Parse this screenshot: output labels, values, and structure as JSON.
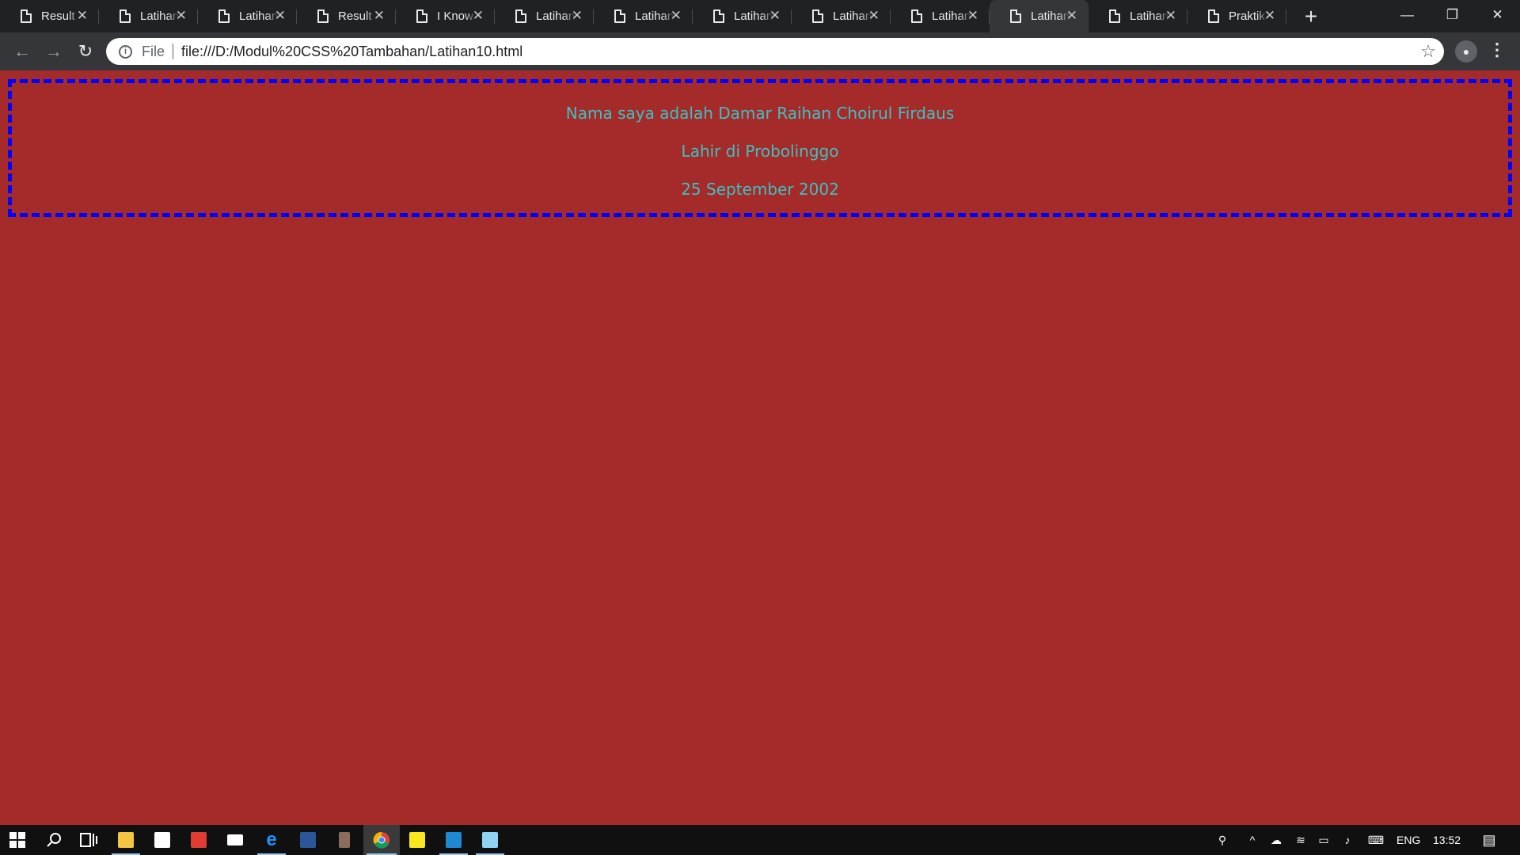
{
  "browser": {
    "tabs": [
      {
        "title": "Result",
        "active": false
      },
      {
        "title": "Latihan",
        "active": false
      },
      {
        "title": "Latihan",
        "active": false
      },
      {
        "title": "Result",
        "active": false
      },
      {
        "title": "I Know",
        "active": false
      },
      {
        "title": "Latihan",
        "active": false
      },
      {
        "title": "Latihan",
        "active": false
      },
      {
        "title": "Latihan",
        "active": false
      },
      {
        "title": "Latihan",
        "active": false
      },
      {
        "title": "Latihan",
        "active": false
      },
      {
        "title": "Latihan",
        "active": true
      },
      {
        "title": "Latihan",
        "active": false
      },
      {
        "title": "Praktik",
        "active": false
      }
    ],
    "tab_close_glyph": "✕",
    "new_tab_glyph": "+",
    "window_controls": {
      "minimize": "—",
      "restore": "❐",
      "close": "✕"
    },
    "toolbar": {
      "back_glyph": "←",
      "forward_glyph": "→",
      "reload_glyph": "↻",
      "scheme_label": "File",
      "url": "file:///D:/Modul%20CSS%20Tambahan/Latihan10.html",
      "star_glyph": "☆",
      "menu_glyph": "⋮"
    }
  },
  "page": {
    "background_color": "#a52a2a",
    "border_color": "#0000ff",
    "text_color": "#40c0c0",
    "lines": {
      "name": "Nama saya adalah Damar Raihan Choirul Firdaus",
      "birthplace": "Lahir di Probolinggo",
      "birthdate": "25 September 2002"
    }
  },
  "taskbar": {
    "icons": [
      "windows-start-icon",
      "search-icon",
      "task-view-icon",
      "file-explorer-icon",
      "store-icon",
      "gift-icon",
      "mail-icon",
      "edge-icon",
      "word-icon",
      "app-icon",
      "chrome-icon",
      "sticky-notes-icon",
      "vscode-icon",
      "notepad-icon"
    ],
    "tray": {
      "language": "ENG",
      "time": "13:52"
    }
  }
}
